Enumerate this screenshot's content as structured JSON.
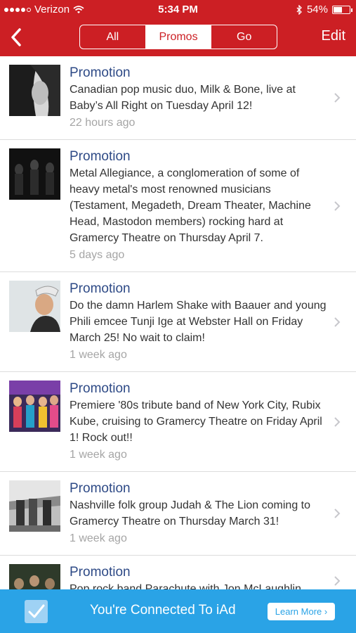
{
  "status_bar": {
    "carrier": "Verizon",
    "time": "5:34 PM",
    "battery": "54%",
    "battery_level": 0.54
  },
  "nav": {
    "back_icon": "chevron-left-icon",
    "tabs": [
      "All",
      "Promos",
      "Go"
    ],
    "active_tab": "Promos",
    "edit_label": "Edit"
  },
  "promotions": [
    {
      "title": "Promotion",
      "text": "Canadian pop music duo, Milk & Bone, live at Baby’s All Right on Tuesday April 12!",
      "time": "22 hours ago"
    },
    {
      "title": "Promotion",
      "text": "Metal Allegiance, a conglomeration of some of heavy metal's most renowned musicians (Testament, Megadeth, Dream Theater, Machine Head, Mastodon members) rocking hard at Gramercy Theatre on Thursday April 7.",
      "time": "5 days ago"
    },
    {
      "title": "Promotion",
      "text": "Do the damn Harlem Shake with Baauer and young Phili emcee Tunji Ige at Webster Hall on Friday March 25! No wait to claim!",
      "time": "1 week ago"
    },
    {
      "title": "Promotion",
      "text": "Premiere '80s tribute band of New York City, Rubix Kube, cruising to Gramercy Theatre on Friday April 1! Rock out!!",
      "time": "1 week ago"
    },
    {
      "title": "Promotion",
      "text": "Nashville folk group Judah & The Lion coming to Gramercy Theatre on Thursday March 31!",
      "time": "1 week ago"
    },
    {
      "title": "Promotion",
      "text": "Pop rock band Parachute with Jon McLaughlin",
      "time": ""
    }
  ],
  "ad_banner": {
    "message": "You're Connected To iAd",
    "button": "Learn More ›",
    "icon": "checkmark-icon"
  },
  "colors": {
    "brand_red": "#cc1f24",
    "title_blue": "#2e4a86",
    "ad_blue": "#2aa3e6"
  }
}
